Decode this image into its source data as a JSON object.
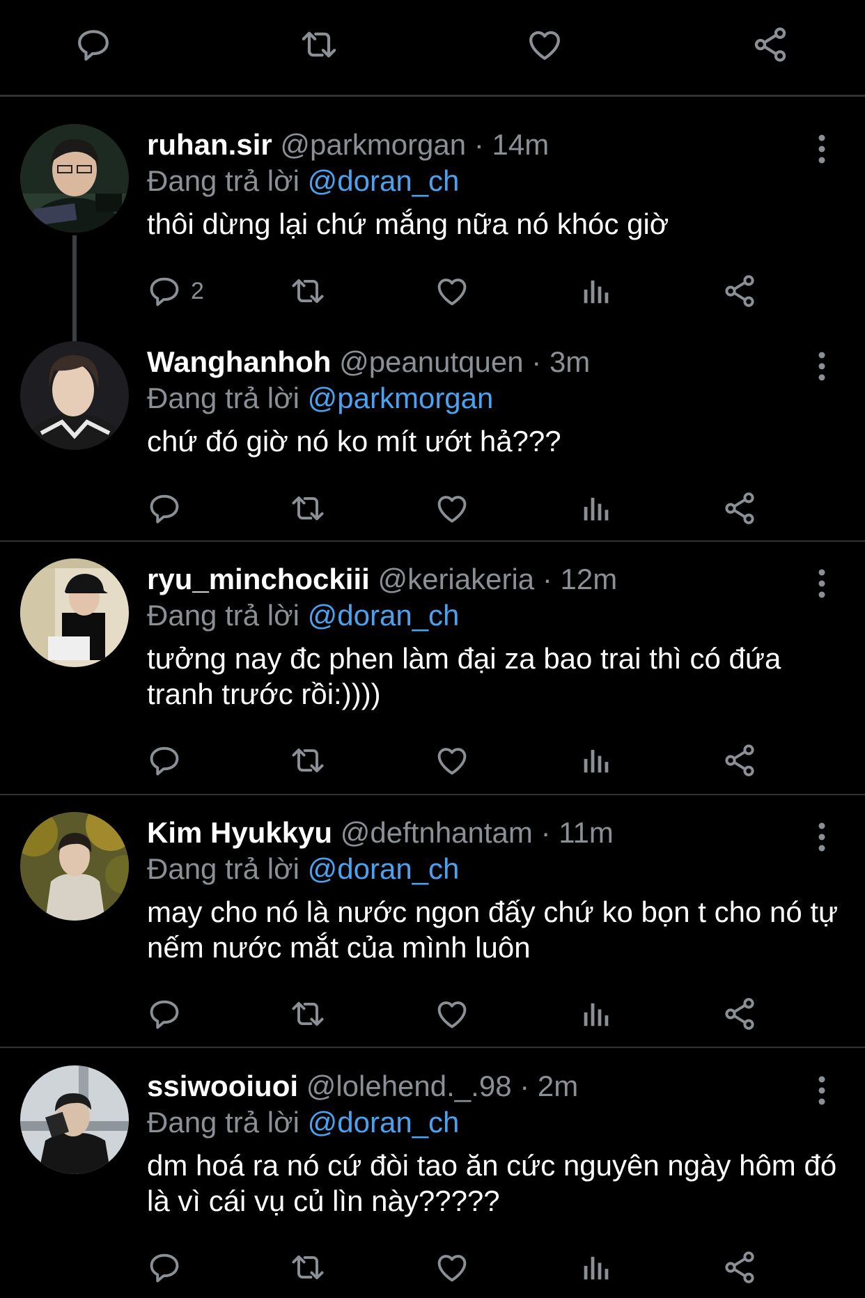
{
  "colors": {
    "background": "#000000",
    "name": "#ffffff",
    "muted": "#8b9096",
    "mention": "#4aa3f0",
    "separator": "#2f3336"
  },
  "top_actions": [
    "reply-icon",
    "retweet-icon",
    "like-icon",
    "share-icon"
  ],
  "tweets": [
    {
      "name": "ruhan.sir",
      "handle": "@parkmorgan",
      "dot": "·",
      "time": "14m",
      "replying_label": "Đang trả lời",
      "replying_to": "@doran_ch",
      "text": "thôi dừng lại chứ mắng nữa nó khóc giờ",
      "reply_count": "2"
    },
    {
      "name": "Wanghanhoh",
      "handle": "@peanutquen",
      "dot": "·",
      "time": "3m",
      "replying_label": "Đang trả lời",
      "replying_to": "@parkmorgan",
      "text": "chứ đó giờ nó ko mít ướt hả???",
      "reply_count": ""
    },
    {
      "name": "ryu_minchockiii",
      "handle": "@keriakeria",
      "dot": "·",
      "time": "12m",
      "replying_label": "Đang trả lời",
      "replying_to": "@doran_ch",
      "text": "tưởng nay đc phen làm đại za bao trai thì có đứa tranh trước rồi:))))",
      "reply_count": ""
    },
    {
      "name": "Kim Hyukkyu",
      "handle": "@deftnhantam",
      "dot": "·",
      "time": "11m",
      "replying_label": "Đang trả lời",
      "replying_to": "@doran_ch",
      "text": "may cho nó là nước ngon đấy chứ ko bọn t cho nó tự nếm nước mắt của mình luôn",
      "reply_count": ""
    },
    {
      "name": "ssiwooiuoi",
      "handle": "@lolehend._.98",
      "dot": "·",
      "time": "2m",
      "replying_label": "Đang trả lời",
      "replying_to": "@doran_ch",
      "text": "dm hoá ra nó cứ đòi tao ăn cức nguyên ngày hôm đó là vì cái vụ củ lìn này?????",
      "reply_count": ""
    }
  ]
}
